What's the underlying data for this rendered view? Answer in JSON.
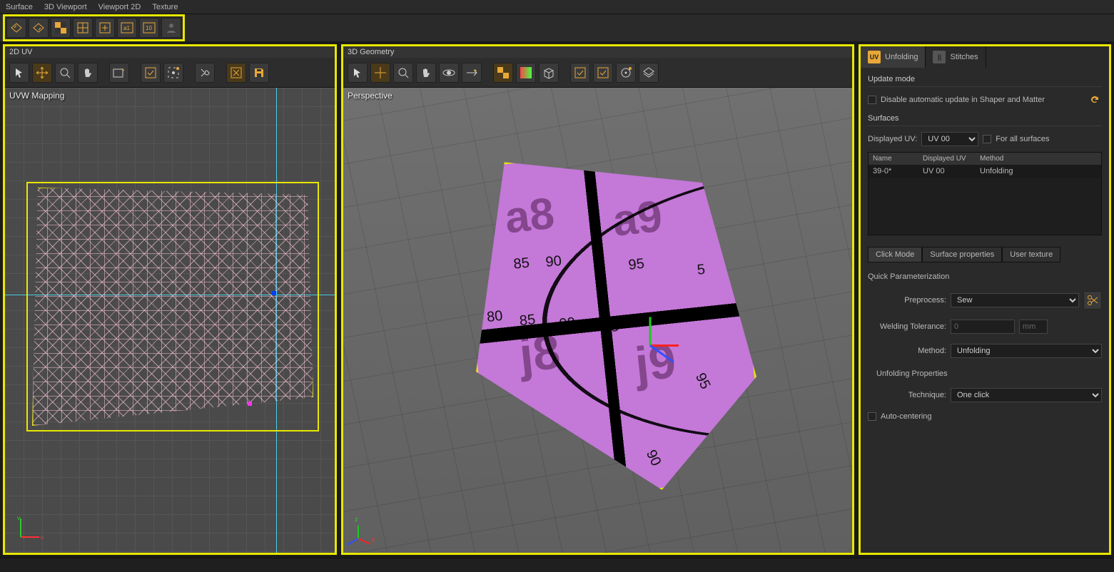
{
  "menu": {
    "surface": "Surface",
    "viewport3d": "3D Viewport",
    "viewport2d": "Viewport 2D",
    "texture": "Texture"
  },
  "panels": {
    "uv2d": {
      "title": "2D UV",
      "viewport_label": "UVW Mapping"
    },
    "geo3d": {
      "title": "3D Geometry",
      "viewport_label": "Perspective"
    }
  },
  "surface_texture": {
    "labels": {
      "a8": "a8",
      "a9": "a9",
      "j8": "j8",
      "j9": "j9"
    },
    "ticks": [
      "80",
      "85",
      "90",
      "95",
      "5",
      "85",
      "90",
      "95",
      "90",
      "95",
      "90"
    ]
  },
  "right": {
    "tabs": {
      "unfolding": "Unfolding",
      "stitches": "Stitches"
    },
    "update_mode": "Update mode",
    "disable_auto": "Disable automatic update in Shaper and Matter",
    "surfaces": "Surfaces",
    "displayed_uv_label": "Displayed UV:",
    "displayed_uv_value": "UV 00",
    "for_all": "For all surfaces",
    "table": {
      "headers": {
        "name": "Name",
        "disp": "Displayed UV",
        "method": "Method"
      },
      "row": {
        "name": "39-0*",
        "disp": "UV 00",
        "method": "Unfolding"
      }
    },
    "subtabs": {
      "click": "Click Mode",
      "surfprops": "Surface properties",
      "usertex": "User texture"
    },
    "quick_param": "Quick Parameterization",
    "preprocess_label": "Preprocess:",
    "preprocess_value": "Sew",
    "weld_label": "Welding Tolerance:",
    "weld_value": "0",
    "weld_unit": "mm",
    "method_label": "Method:",
    "method_value": "Unfolding",
    "unfold_props": "Unfolding Properties",
    "technique_label": "Technique:",
    "technique_value": "One click",
    "auto_center": "Auto-centering"
  },
  "uv_axis": {
    "u": "u",
    "v": "v"
  },
  "geo_axis": {
    "x": "x",
    "z": "z"
  }
}
